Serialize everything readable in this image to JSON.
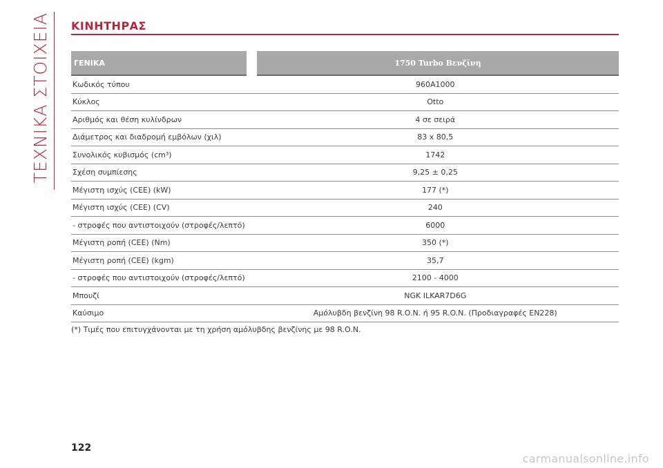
{
  "side_title": "ΤΕΧΝΙΚΑ ΣΤΟΙΧΕΙΑ",
  "section_title": "ΚΙΝΗΤΗΡΑΣ",
  "table": {
    "headers": [
      "ΓΕΝΙΚΑ",
      "1750 Turbo Βενζίνη"
    ],
    "rows": [
      {
        "label": "Κωδικός τύπου",
        "value": "960A1000"
      },
      {
        "label": "Κύκλος",
        "value": "Otto"
      },
      {
        "label": "Αριθμός και θέση κυλίνδρων",
        "value": "4 σε σειρά"
      },
      {
        "label": "Διάμετρος και διαδρομή εμβόλων (χιλ)",
        "value": "83 x 80,5"
      },
      {
        "label": "Συνολικός κυβισμός (cm³)",
        "value": "1742"
      },
      {
        "label": "Σχέση συμπίεσης",
        "value": "9,25 ± 0,25"
      },
      {
        "label": "Μέγιστη ισχύς (CEE) (kW)",
        "value": "177 (*)"
      },
      {
        "label": "Μέγιστη ισχύς (CEE) (CV)",
        "value": "240"
      },
      {
        "label": "- στροφές που αντιστοιχούν (στροφές/λεπτό)",
        "value": "6000"
      },
      {
        "label": "Μέγιστη ροπή (CEE) (Nm)",
        "value": "350 (*)"
      },
      {
        "label": "Μέγιστη ροπή (CEE) (kgm)",
        "value": "35,7"
      },
      {
        "label": "- στροφές που αντιστοιχούν (στροφές/λεπτό)",
        "value": "2100 - 4000"
      },
      {
        "label": "Μπουζί",
        "value": "NGK ILKAR7D6G"
      },
      {
        "label": "Καύσιμο",
        "value": "Αμόλυβδη βενζίνη 98 R.O.N. ή 95 R.O.N. (Προδιαγραφές EN228)"
      }
    ]
  },
  "footnote": "(*) Τιμές που επιτυγχάνονται με τη χρήση αμόλυβδης βενζίνης με 98 R.O.N.",
  "page_number": "122",
  "watermark": "carmanualsonline.info",
  "colors": {
    "accent": "#b5263a",
    "header_bg": "#a9a9a9"
  }
}
